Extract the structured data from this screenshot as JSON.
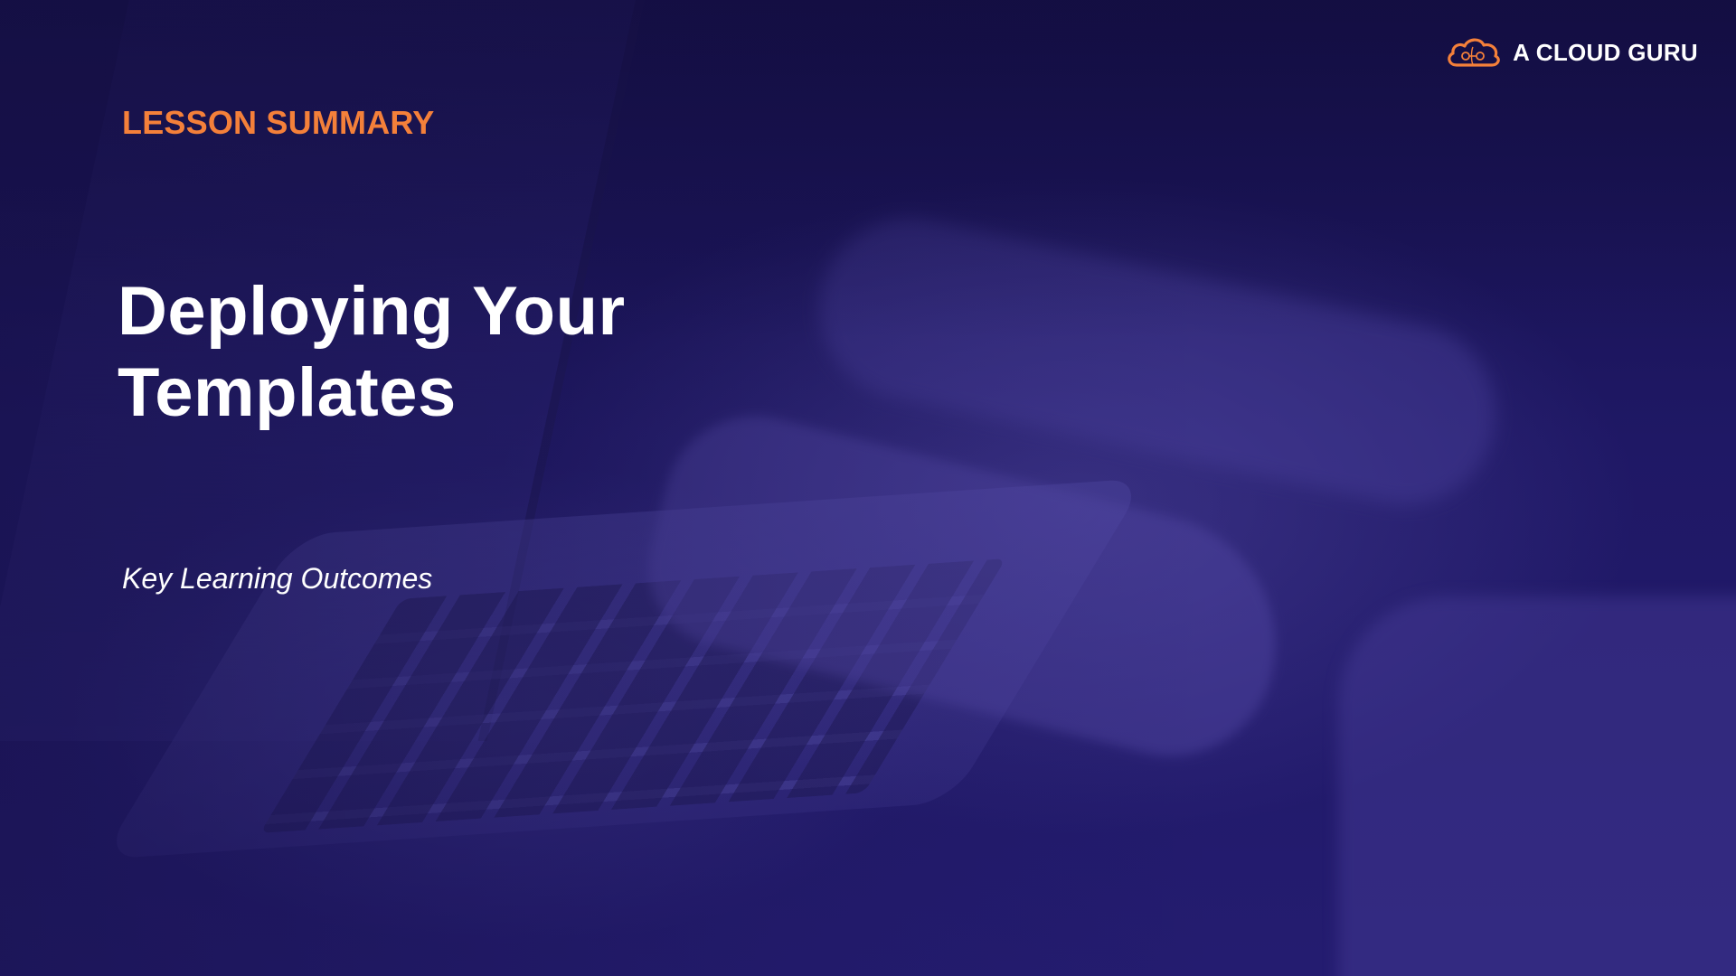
{
  "brand": {
    "icon": "cloud-logo-icon",
    "name": "A CLOUD GURU",
    "accent_color": "#f4803a"
  },
  "slide": {
    "eyebrow": "LESSON SUMMARY",
    "title_line_1": "Deploying Your",
    "title_line_2": "Templates",
    "subtitle": "Key Learning Outcomes",
    "background_color": "#1e1660",
    "eyebrow_color": "#f4803a",
    "text_color": "#ffffff"
  }
}
